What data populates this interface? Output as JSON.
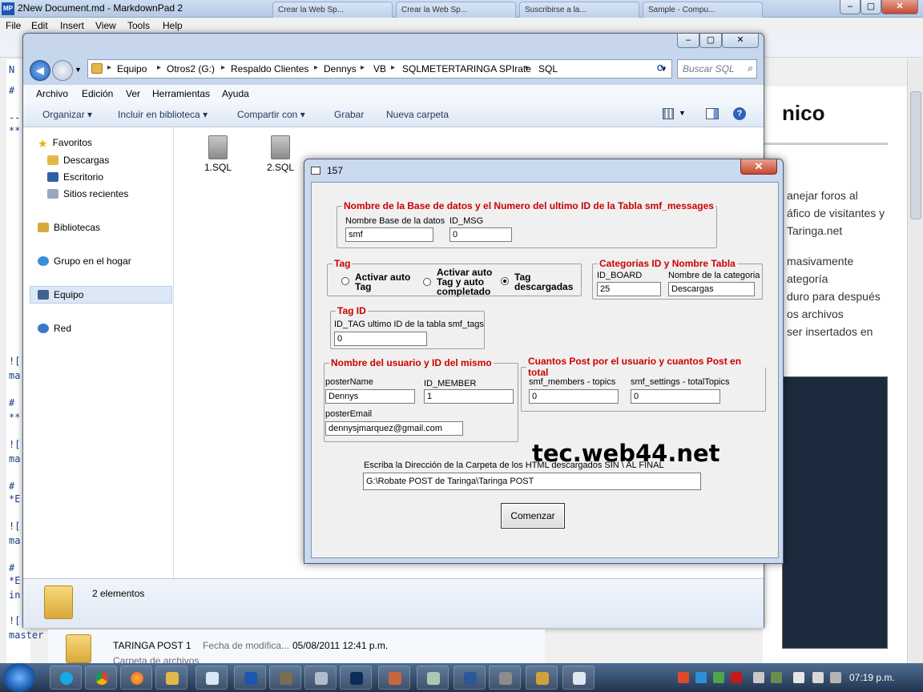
{
  "markdownpad": {
    "title": "2New Document.md - MarkdownPad 2",
    "menu": [
      "File",
      "Edit",
      "Insert",
      "View",
      "Tools",
      "Help"
    ],
    "bg_tabs": [
      "Crear la Web Sp...",
      "Crear la Web Sp...",
      "Suscribirse a la...",
      "Sample - Compu..."
    ],
    "editor_lines": [
      "N",
      "#",
      "--",
      "**",
      "![",
      "ma",
      "#",
      "**",
      "![",
      "ma",
      "#",
      "*E",
      "![",
      "ma",
      "#",
      "*E",
      "in",
      "![",
      "master"
    ],
    "preview": {
      "heading": "nico",
      "lines": [
        "anejar foros al",
        "áfico de visitantes y",
        "Taringa.net",
        "masivamente",
        "ategoría",
        "duro para después",
        "os archivos",
        "ser insertados en"
      ]
    }
  },
  "explorer": {
    "breadcrumbs": [
      "Equipo",
      "Otros2 (G:)",
      "Respaldo Clientes",
      "Dennys",
      "VB",
      "SQLMETERTARINGA SPIrate",
      "SQL"
    ],
    "search_placeholder": "Buscar SQL",
    "menu": [
      "Archivo",
      "Edición",
      "Ver",
      "Herramientas",
      "Ayuda"
    ],
    "commands": {
      "organize": "Organizar",
      "include": "Incluir en biblioteca",
      "share": "Compartir con",
      "burn": "Grabar",
      "new_folder": "Nueva carpeta"
    },
    "nav": {
      "favorites": "Favoritos",
      "downloads": "Descargas",
      "desktop": "Escritorio",
      "recent": "Sitios recientes",
      "libraries": "Bibliotecas",
      "homegroup": "Grupo en el hogar",
      "computer": "Equipo",
      "network": "Red"
    },
    "files": [
      "1.SQL",
      "2.SQL"
    ],
    "status": "2 elementos"
  },
  "taringa_row": {
    "name": "TARINGA POST 1",
    "date_label": "Fecha de modifica...",
    "date": "05/08/2011 12:41 p.m.",
    "type": "Carpeta de archivos"
  },
  "dialog": {
    "title": "157",
    "db_group": {
      "legend": "Nombre de la Base de datos y el Numero del ultimo ID de la Tabla smf_messages",
      "db_label": "Nombre Base de la datos",
      "db_value": "smf",
      "msg_label": "ID_MSG",
      "msg_value": "0"
    },
    "tag_group": {
      "legend": "Tag",
      "options": [
        "Activar auto\nTag",
        "Activar auto\nTag y auto\ncompletado",
        "Tag\ndescargadas"
      ],
      "selected": 2
    },
    "cat_group": {
      "legend": "Categorias ID y Nombre Tabla",
      "board_label": "ID_BOARD",
      "board_value": "25",
      "name_label": "Nombre de la categoria",
      "name_value": "Descargas"
    },
    "tagid_group": {
      "legend": "Tag ID",
      "label": "ID_TAG ultimo ID de la tabla smf_tags",
      "value": "0"
    },
    "user_group": {
      "legend": "Nombre del usuario y ID del mismo",
      "poster_name_label": "posterName",
      "poster_name_value": "Dennys",
      "member_label": "ID_MEMBER",
      "member_value": "1",
      "email_label": "posterEmail",
      "email_value": "dennysjmarquez@gmail.com"
    },
    "posts_group": {
      "legend": "Cuantos Post por el usuario y cuantos Post en total",
      "topics_label": "smf_members - topics",
      "topics_value": "0",
      "total_label": "smf_settings - totalTopics",
      "total_value": "0"
    },
    "watermark": "tec.web44.net",
    "path_label": "Escriba la Dirección de la Carpeta de los HTML descargados SIN \\ AL FINAL",
    "path_value": "G:\\Robate POST de Taringa\\Taringa POST",
    "start_button": "Comenzar"
  },
  "taskbar": {
    "clock": "07:19 p.m."
  }
}
